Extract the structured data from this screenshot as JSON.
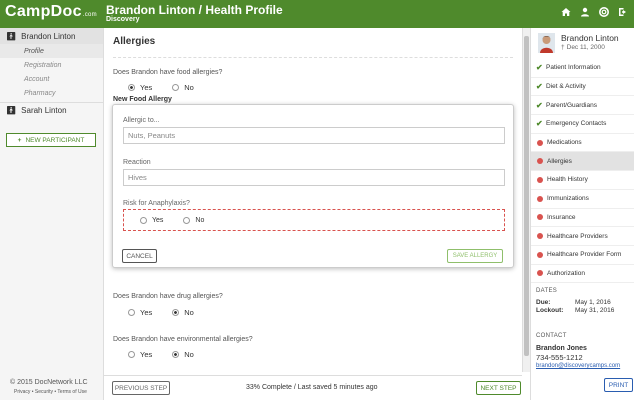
{
  "header": {
    "logo": "CampDoc",
    "logo_suffix": ".com",
    "title": "Brandon Linton / Health Profile",
    "subtitle": "Discovery",
    "bg_color": "#4f8a2c",
    "icons": [
      "home-icon",
      "user-icon",
      "help-icon",
      "logout-icon"
    ]
  },
  "left_sidebar": {
    "participants": [
      {
        "name": "Brandon Linton",
        "icon": "person-icon"
      },
      {
        "name": "Sarah Linton",
        "icon": "person-icon"
      }
    ],
    "sub_items": [
      "Profile",
      "Registration",
      "Account",
      "Pharmacy"
    ],
    "new_participant": "NEW PARTICIPANT",
    "new_participant_icon": "plus-icon",
    "copyright": "© 2015 DocNetwork LLC",
    "footer_links": "Privacy • Security • Terms of Use"
  },
  "main": {
    "title": "Allergies",
    "food_question": "Does Brandon have food allergies?",
    "food_answer": "Yes",
    "yes_label": "Yes",
    "no_label": "No",
    "new_allergy_label": "New Food Allergy",
    "modal": {
      "allergic_to_label": "Allergic to...",
      "allergic_to_value": "Nuts, Peanuts",
      "reaction_label": "Reaction",
      "reaction_value": "Hives",
      "anaphylaxis_label": "Risk for Anaphylaxis?",
      "cancel": "CANCEL",
      "save": "SAVE ALLERGY"
    },
    "drug_question": "Does Brandon have drug allergies?",
    "drug_answer": "No",
    "env_question": "Does Brandon have environmental allergies?",
    "env_answer": "No",
    "prev_step": "PREVIOUS STEP",
    "progress": "33% Complete / Last saved 5 minutes ago",
    "next_step": "NEXT STEP"
  },
  "right_sidebar": {
    "name": "Brandon Linton",
    "dob": "Dec 11, 2000",
    "nav": [
      {
        "label": "Patient Information",
        "status": "complete"
      },
      {
        "label": "Diet & Activity",
        "status": "complete"
      },
      {
        "label": "Parent/Guardians",
        "status": "complete"
      },
      {
        "label": "Emergency Contacts",
        "status": "complete"
      },
      {
        "label": "Medications",
        "status": "incomplete"
      },
      {
        "label": "Allergies",
        "status": "incomplete",
        "active": true
      },
      {
        "label": "Health History",
        "status": "incomplete"
      },
      {
        "label": "Immunizations",
        "status": "incomplete"
      },
      {
        "label": "Insurance",
        "status": "incomplete"
      },
      {
        "label": "Healthcare Providers",
        "status": "incomplete"
      },
      {
        "label": "Healthcare Provider Form",
        "status": "incomplete"
      },
      {
        "label": "Authorization",
        "status": "incomplete"
      }
    ],
    "dates_label": "DATES",
    "due_label": "Due:",
    "due_value": "May 1, 2016",
    "lockout_label": "Lockout:",
    "lockout_value": "May 31, 2016",
    "contact_label": "CONTACT",
    "contact_name": "Brandon Jones",
    "contact_phone": "734-555-1212",
    "contact_email": "brandon@discoverycamps.com",
    "print": "PRINT"
  }
}
